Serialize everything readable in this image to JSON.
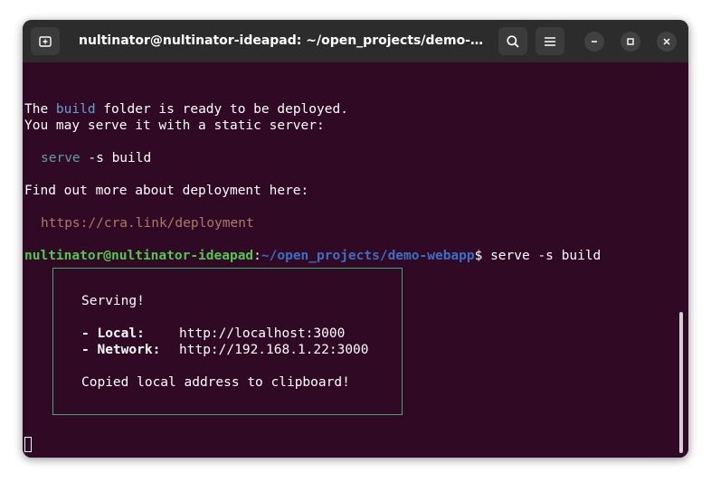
{
  "window": {
    "title": "nultinator@nultinator-ideapad: ~/open_projects/demo-webapp"
  },
  "icons": {
    "new_tab": "new-tab-icon",
    "search": "search-icon",
    "menu": "hamburger-menu-icon",
    "minimize": "minimize-icon",
    "maximize": "maximize-icon",
    "close": "close-icon"
  },
  "colors": {
    "terminal_bg": "#300a24",
    "titlebar_bg": "#2c2c2c",
    "prompt_user": "#4ec94e",
    "prompt_path": "#3b6fc4",
    "box_border": "#3da872"
  },
  "terminal": {
    "line1": {
      "pre": "The ",
      "word": "build",
      "post": " folder is ready to be deployed."
    },
    "line2": "You may serve it with a static server:",
    "serve_cmd": {
      "cmd": "serve",
      "args": " -s build"
    },
    "line4": "Find out more about deployment here:",
    "deploy_link": "https://cra.link/deployment",
    "prompt": {
      "user": "nultinator@nultinator-ideapad",
      "sep": ":",
      "path": "~/open_projects/demo-webapp",
      "symbol": "$",
      "command": " serve -s build"
    },
    "box": {
      "serving": "Serving!",
      "local_label": "- Local:",
      "local_url": "http://localhost:3000",
      "network_label": "- Network:",
      "network_url": "http://192.168.1.22:3000",
      "copied": "Copied local address to clipboard!"
    }
  }
}
